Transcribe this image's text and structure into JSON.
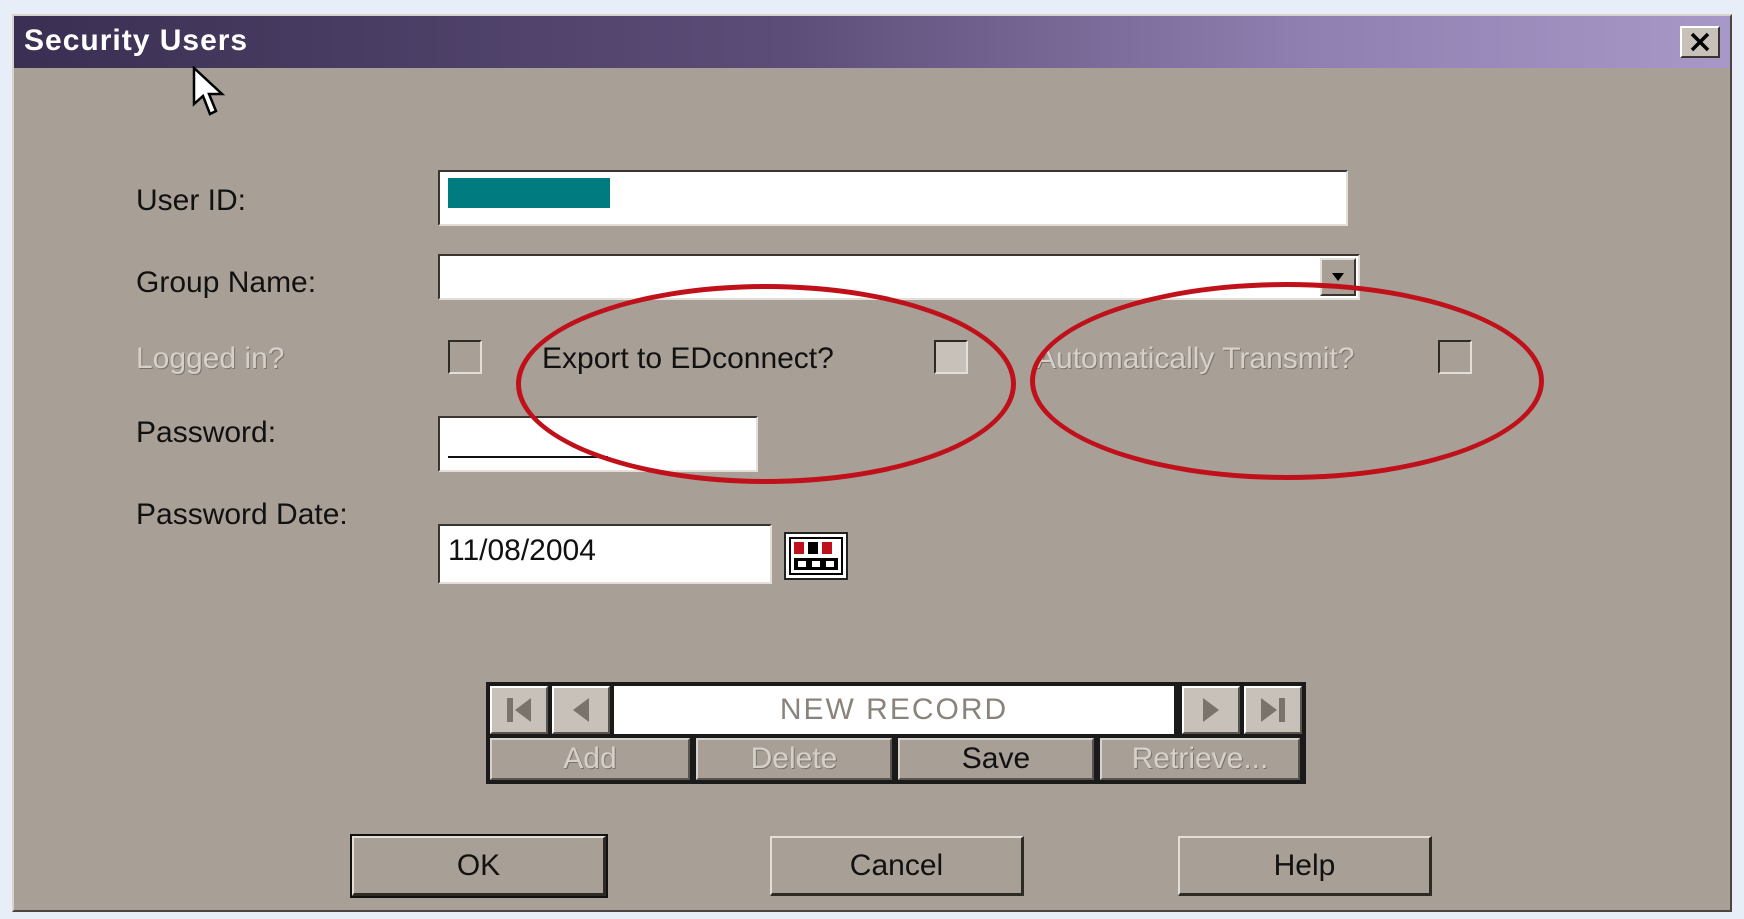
{
  "window": {
    "title": "Security Users",
    "close_icon": "close-icon"
  },
  "form": {
    "user_id_label": "User ID:",
    "user_id_value": "",
    "group_name_label": "Group Name:",
    "group_name_value": "",
    "logged_in_label": "Logged in?",
    "export_label": "Export to EDconnect?",
    "auto_transmit_label": "Automatically Transmit?",
    "password_label": "Password:",
    "password_value": "",
    "password_date_label": "Password Date:",
    "password_date_value": "11/08/2004"
  },
  "record_nav": {
    "status": "NEW RECORD",
    "add_label": "Add",
    "delete_label": "Delete",
    "save_label": "Save",
    "retrieve_label": "Retrieve..."
  },
  "buttons": {
    "ok_label": "OK",
    "cancel_label": "Cancel",
    "help_label": "Help"
  },
  "colors": {
    "dialog_bg": "#a89f96",
    "selection": "#007b7f",
    "annotation": "#c0101a"
  }
}
